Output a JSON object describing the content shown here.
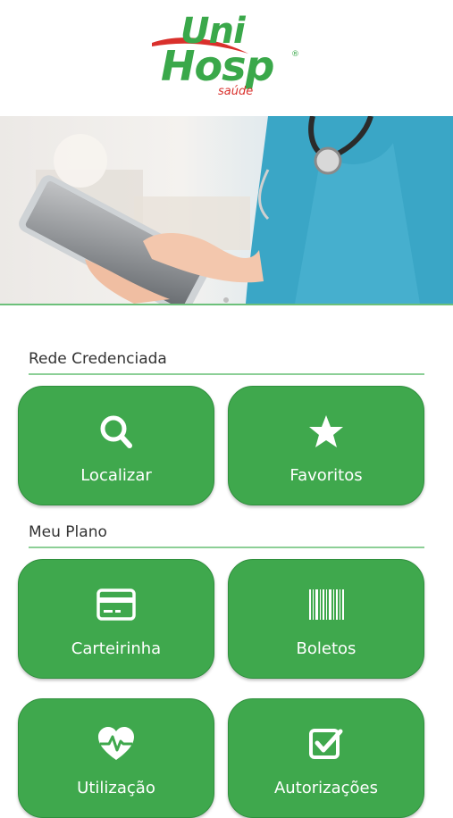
{
  "header": {
    "logo": {
      "line1": "Uni",
      "line2": "Hosp",
      "tagline": "saúde",
      "registered": "®"
    }
  },
  "banner": {
    "description_icon": "nurse-tablet-photo"
  },
  "sections": [
    {
      "title": "Rede Credenciada",
      "tiles": [
        {
          "label": "Localizar",
          "icon": "search-icon"
        },
        {
          "label": "Favoritos",
          "icon": "star-icon"
        }
      ]
    },
    {
      "title": "Meu Plano",
      "tiles": [
        {
          "label": "Carteirinha",
          "icon": "card-icon"
        },
        {
          "label": "Boletos",
          "icon": "barcode-icon"
        },
        {
          "label": "Utilização",
          "icon": "heartbeat-icon"
        },
        {
          "label": "Autorizações",
          "icon": "checkbox-icon"
        }
      ]
    }
  ],
  "colors": {
    "brand_green": "#3fa84d",
    "brand_red": "#d9302c",
    "divider": "#8ccf96"
  }
}
